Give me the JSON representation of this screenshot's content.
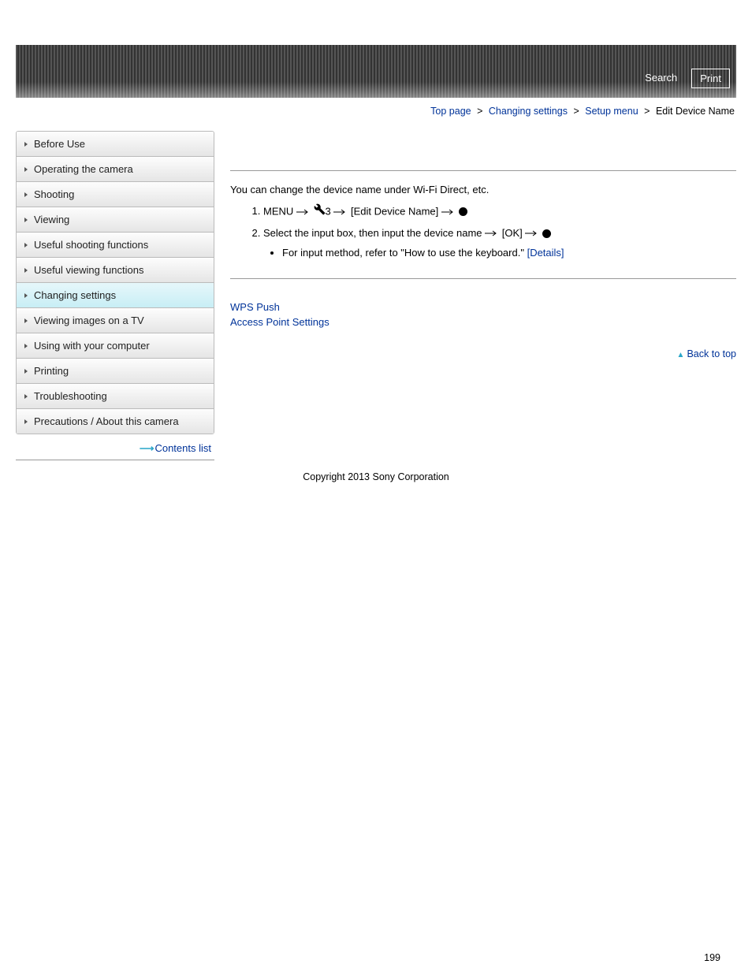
{
  "header": {
    "search": "Search",
    "print": "Print"
  },
  "breadcrumb": {
    "items": [
      "Top page",
      "Changing settings",
      "Setup menu"
    ],
    "current": "Edit Device Name",
    "sep": ">"
  },
  "sidebar": {
    "items": [
      "Before Use",
      "Operating the camera",
      "Shooting",
      "Viewing",
      "Useful shooting functions",
      "Useful viewing functions",
      "Changing settings",
      "Viewing images on a TV",
      "Using with your computer",
      "Printing",
      "Troubleshooting",
      "Precautions / About this camera"
    ],
    "active_index": 6,
    "contents_list": "Contents list"
  },
  "content": {
    "intro": "You can change the device name under Wi-Fi Direct, etc.",
    "step1_menu": "MENU",
    "step1_num": "3",
    "step1_target": "[Edit Device Name]",
    "step2_text": "Select the input box, then input the device name",
    "step2_ok": "[OK]",
    "step2_sub_prefix": "For input method, refer to \"How to use the keyboard.\"",
    "step2_sub_link": "[Details]",
    "related": {
      "wps": "WPS Push",
      "aps": "Access Point Settings"
    },
    "backtop": "Back to top"
  },
  "footer": {
    "copyright": "Copyright 2013 Sony Corporation",
    "page": "199"
  }
}
